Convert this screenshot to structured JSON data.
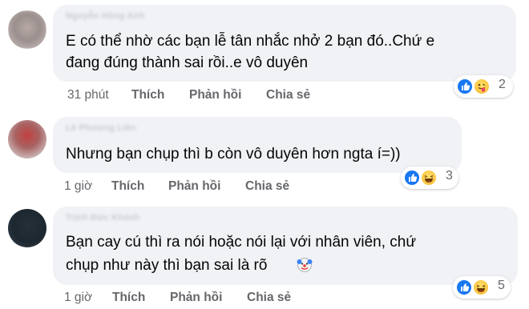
{
  "comments": [
    {
      "author": "Nguyễn Hồng Anh",
      "lines": [
        "E có thể nhờ các bạn lễ tân nhắc nhở 2 bạn đó..Chứ e",
        "đang đúng thành sai rồi..e vô duyên"
      ],
      "time": "31 phút",
      "like_label": "Thích",
      "reply_label": "Phản hồi",
      "share_label": "Chia sẻ",
      "reaction_count": "2",
      "reactions": [
        "like-icon",
        "tongue-emoji-icon"
      ]
    },
    {
      "author": "Lê Phương Liên",
      "lines": [
        "Nhưng bạn chụp thì b còn vô duyên hơn ngta í=))"
      ],
      "time": "1 giờ",
      "like_label": "Thích",
      "reply_label": "Phản hồi",
      "share_label": "Chia sẻ",
      "reaction_count": "3",
      "reactions": [
        "like-icon",
        "haha-icon"
      ]
    },
    {
      "author": "Trịnh Đức Khánh",
      "lines": [
        "Bạn cay cú thì ra nói hoặc nói lại với nhân viên, chứ",
        "chụp như này thì bạn sai là rõ"
      ],
      "inline_emoji": "clown-emoji-icon",
      "time": "1 giờ",
      "like_label": "Thích",
      "reply_label": "Phản hồi",
      "share_label": "Chia sẻ",
      "reaction_count": "5",
      "reactions": [
        "like-icon",
        "haha-icon"
      ]
    }
  ],
  "colors": {
    "bubble": "#f0f2f5",
    "like": "#1877f2",
    "meta_text": "#65676b",
    "text": "#050505"
  }
}
